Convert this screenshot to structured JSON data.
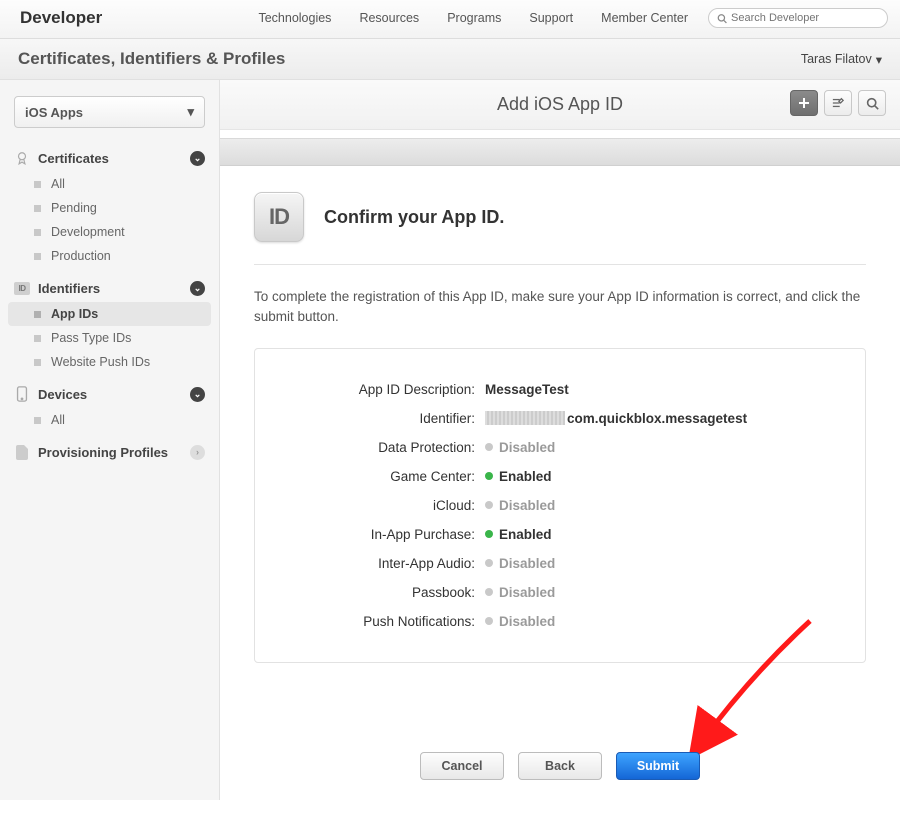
{
  "header": {
    "brand": "Developer",
    "nav": [
      "Technologies",
      "Resources",
      "Programs",
      "Support",
      "Member Center"
    ],
    "search_placeholder": "Search Developer"
  },
  "subheader": {
    "title": "Certificates, Identifiers & Profiles",
    "user": "Taras Filatov"
  },
  "sidebar": {
    "platform": "iOS Apps",
    "groups": [
      {
        "label": "Certificates",
        "items": [
          "All",
          "Pending",
          "Development",
          "Production"
        ]
      },
      {
        "label": "Identifiers",
        "items": [
          "App IDs",
          "Pass Type IDs",
          "Website Push IDs"
        ],
        "active_index": 0
      },
      {
        "label": "Devices",
        "items": [
          "All"
        ]
      },
      {
        "label": "Provisioning Profiles",
        "items": [],
        "collapsed": true
      }
    ]
  },
  "main": {
    "page_title": "Add iOS App ID",
    "confirm_heading": "Confirm your App ID.",
    "instruction": "To complete the registration of this App ID, make sure your App ID information is correct, and click the submit button.",
    "fields": [
      {
        "label": "App ID Description:",
        "value": "MessageTest",
        "type": "text"
      },
      {
        "label": "Identifier:",
        "value": "com.quickblox.messagetest",
        "type": "id",
        "obscured_prefix": true
      },
      {
        "label": "Data Protection:",
        "value": "Disabled",
        "type": "status",
        "enabled": false
      },
      {
        "label": "Game Center:",
        "value": "Enabled",
        "type": "status",
        "enabled": true
      },
      {
        "label": "iCloud:",
        "value": "Disabled",
        "type": "status",
        "enabled": false
      },
      {
        "label": "In-App Purchase:",
        "value": "Enabled",
        "type": "status",
        "enabled": true
      },
      {
        "label": "Inter-App Audio:",
        "value": "Disabled",
        "type": "status",
        "enabled": false
      },
      {
        "label": "Passbook:",
        "value": "Disabled",
        "type": "status",
        "enabled": false
      },
      {
        "label": "Push Notifications:",
        "value": "Disabled",
        "type": "status",
        "enabled": false
      }
    ],
    "buttons": {
      "cancel": "Cancel",
      "back": "Back",
      "submit": "Submit"
    },
    "id_tile_text": "ID"
  }
}
